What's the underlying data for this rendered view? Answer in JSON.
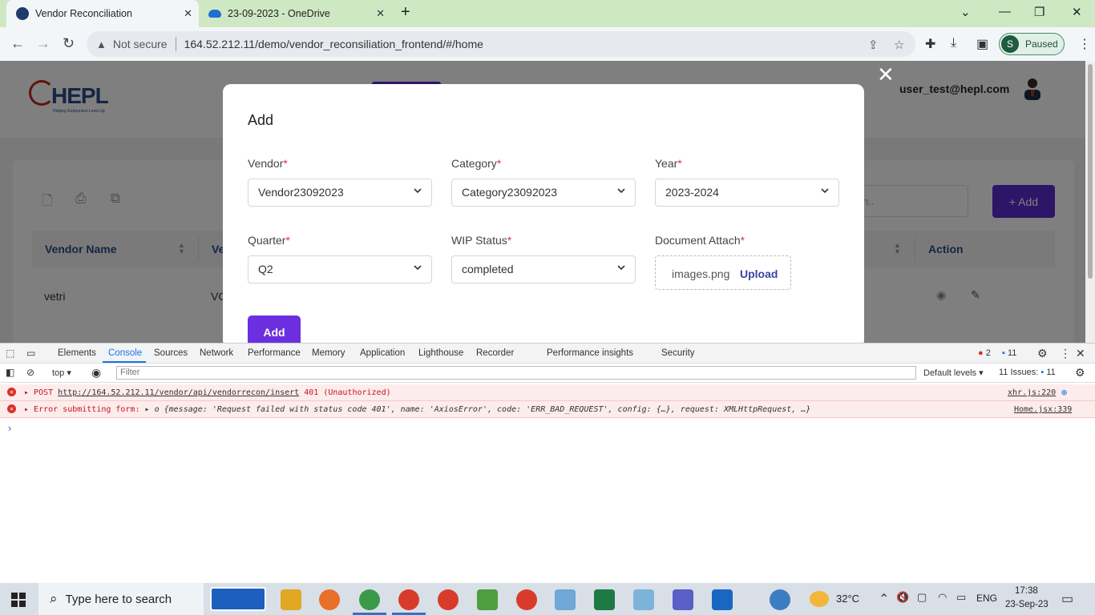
{
  "browser": {
    "tabs": [
      {
        "title": "Vendor Reconciliation",
        "active": true
      },
      {
        "title": "23-09-2023 - OneDrive",
        "active": false
      }
    ],
    "new_tab": "+",
    "omnibox": {
      "security": "Not secure",
      "url": "164.52.212.11/demo/vendor_reconsiliation_frontend/#/home"
    },
    "profile": {
      "initial": "S",
      "status": "Paused"
    }
  },
  "app": {
    "logo": {
      "text": "HEPL",
      "tagline": "Helping Enterprises Level Up"
    },
    "user_email": "user_test@hepl.com",
    "search_placeholder": "h..",
    "add_button": "+ Add",
    "table": {
      "headers": [
        "Vendor Name",
        "Ve",
        "Action"
      ],
      "rows": [
        [
          "vetri",
          "VC"
        ]
      ]
    }
  },
  "modal": {
    "title": "Add",
    "fields": {
      "vendor": {
        "label": "Vendor",
        "value": "Vendor23092023"
      },
      "category": {
        "label": "Category",
        "value": "Category23092023"
      },
      "year": {
        "label": "Year",
        "value": "2023-2024"
      },
      "quarter": {
        "label": "Quarter",
        "value": "Q2"
      },
      "wip_status": {
        "label": "WIP Status",
        "value": "completed"
      },
      "document": {
        "label": "Document Attach",
        "file": "images.png",
        "upload": "Upload"
      }
    },
    "required_mark": "*",
    "submit": "Add"
  },
  "devtools": {
    "tabs": [
      "Elements",
      "Console",
      "Sources",
      "Network",
      "Performance",
      "Memory",
      "Application",
      "Lighthouse",
      "Recorder",
      "Performance insights",
      "Security"
    ],
    "active_tab": "Console",
    "error_count": "2",
    "message_count": "11",
    "context": "top",
    "filter_placeholder": "Filter",
    "levels": "Default levels",
    "issues_label": "11 Issues:",
    "issues_count": "11",
    "console": [
      {
        "prefix": "POST",
        "url": "http://164.52.212.11/vendor/api/vendorrecon/insert",
        "text": "401 (Unauthorized)",
        "source": "xhr.js:220"
      },
      {
        "text": "Error submitting form:",
        "detail": "o {message: 'Request failed with status code 401', name: 'AxiosError', code: 'ERR_BAD_REQUEST', config: {…}, request: XMLHttpRequest, …}",
        "source": "Home.jsx:339"
      }
    ],
    "prompt": "›"
  },
  "taskbar": {
    "search": "Type here to search",
    "temperature": "32°C",
    "language": "ENG",
    "time": "17:38",
    "date": "23-Sep-23"
  },
  "colors": {
    "accent": "#5b2bd1",
    "tabbar": "#cfe8c4",
    "error": "#c4171a"
  }
}
